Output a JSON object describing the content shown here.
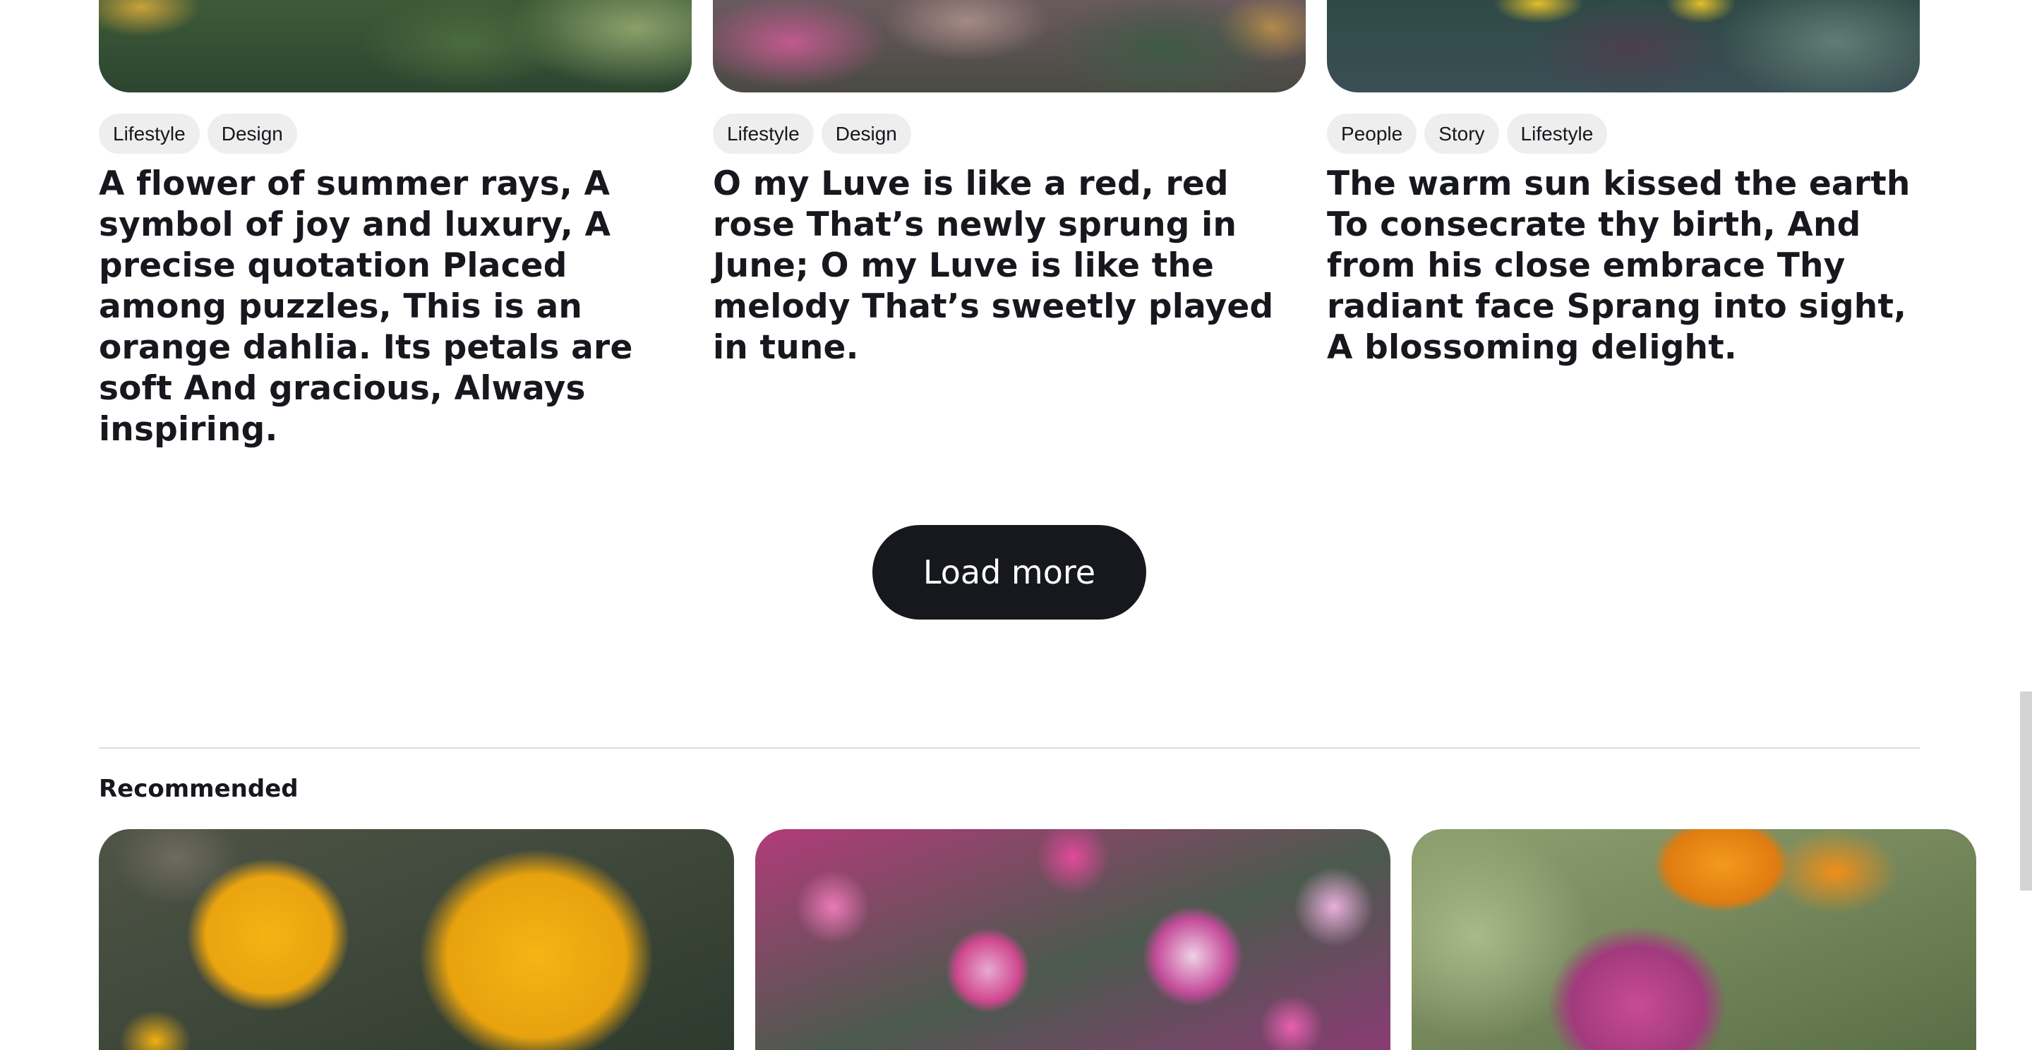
{
  "articles": [
    {
      "tags": [
        "Lifestyle",
        "Design"
      ],
      "title": "A flower of summer rays, A symbol of joy and luxury, A precise quotation Placed among puzzles, This is an orange dahlia. Its petals are soft And gracious, Always inspiring."
    },
    {
      "tags": [
        "Lifestyle",
        "Design"
      ],
      "title": "O my Luve is like a red, red rose That’s newly sprung in June; O my Luve is like the melody That’s sweetly played in tune."
    },
    {
      "tags": [
        "People",
        "Story",
        "Lifestyle"
      ],
      "title": "The warm sun kissed the earth To consecrate thy birth, And from his close embrace Thy radiant face Sprang into sight, A blossoming delight."
    }
  ],
  "load_more_label": "Load more",
  "recommended": {
    "title": "Recommended"
  }
}
